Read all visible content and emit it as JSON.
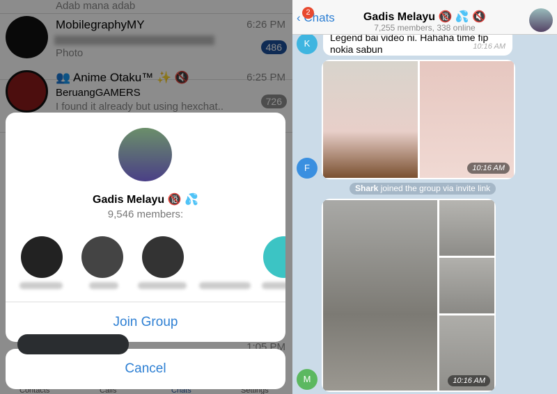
{
  "left": {
    "chats": [
      {
        "name": "",
        "text": "Adab mana adab"
      },
      {
        "name": "MobilegraphyMY",
        "time": "6:26 PM",
        "text": "Photo",
        "badge": "486",
        "badge_color": "#1d4f9a"
      },
      {
        "name": "👥 Anime Otaku™ ✨ 🔇",
        "time": "6:25 PM",
        "sender": "BeruangGAMERS",
        "text": "I found it already but using hexchat..",
        "badge": "726",
        "badge_color": "#8d8d8d"
      },
      {
        "time": "1:05 PM"
      }
    ],
    "dialog": {
      "title": "Gadis Melayu 🔞 💦",
      "members": "9,546 members:",
      "join_label": "Join Group",
      "cancel_label": "Cancel"
    },
    "tabs": [
      "Contacts",
      "Calls",
      "Chats",
      "Settings"
    ]
  },
  "right": {
    "header": {
      "back_label": "Chats",
      "back_badge": "2",
      "title": "Gadis Melayu 🔞 💦 🔇",
      "subtitle": "7,255 members, 338 online"
    },
    "messages": [
      {
        "avatar": "K",
        "avatar_color": "#3fb5e0",
        "text": "Legend bai video ni. Hahaha time fip nokia sabun",
        "time": "10:16 AM"
      },
      {
        "avatar": "F",
        "avatar_color": "#3a8fe0",
        "time": "10:16 AM"
      },
      {
        "service_name": "Shark",
        "service_text": " joined the group via invite link"
      },
      {
        "avatar": "M",
        "avatar_color": "#5cb860",
        "time": "10:16 AM"
      }
    ]
  }
}
